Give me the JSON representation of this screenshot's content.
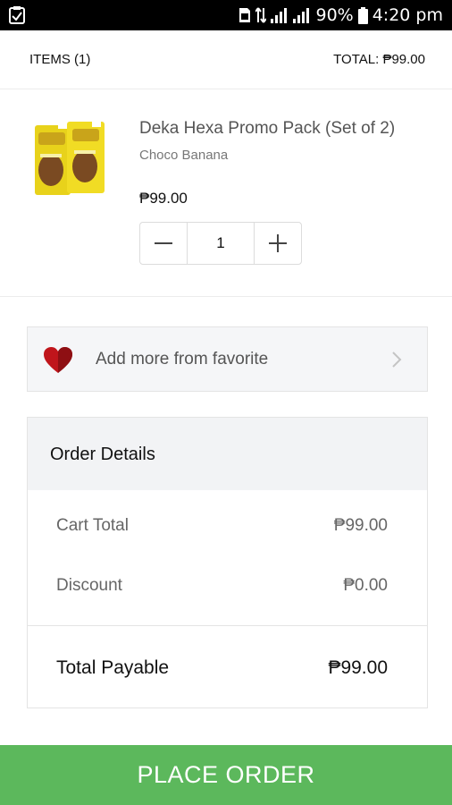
{
  "statusbar": {
    "battery": "90%",
    "time": "4:20 pm"
  },
  "header": {
    "items_label": "ITEMS (1)",
    "total_label": "TOTAL: ₱99.00"
  },
  "cart": {
    "items": [
      {
        "name": "Deka Hexa Promo Pack (Set of 2)",
        "variant": "Choco Banana",
        "price": "₱99.00",
        "quantity": "1"
      }
    ]
  },
  "favorite": {
    "label": "Add more from favorite"
  },
  "order_details": {
    "title": "Order Details",
    "cart_total_label": "Cart Total",
    "cart_total_value": "₱99.00",
    "discount_label": "Discount",
    "discount_value": "₱0.00",
    "total_payable_label": "Total Payable",
    "total_payable_value": "₱99.00"
  },
  "actions": {
    "place_order": "PLACE ORDER"
  },
  "colors": {
    "primary_button": "#5cb85c",
    "heart": "#c0151b"
  }
}
